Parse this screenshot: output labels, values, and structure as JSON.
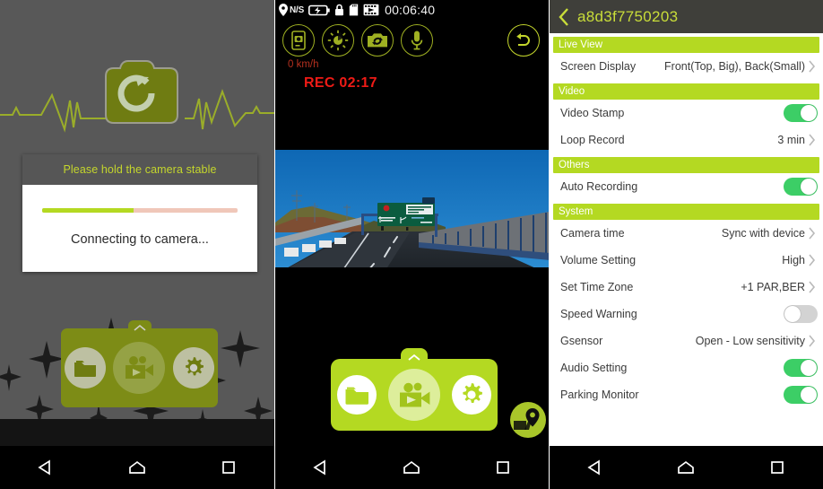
{
  "panels": {
    "connect": {
      "name": "Connecting screen",
      "dialog": {
        "title": "Please hold the camera stable",
        "message": "Connecting to camera...",
        "progress_percent": 47,
        "progress_fill_color": "#b4d922",
        "progress_track_color": "#f0c7b9"
      },
      "logo_icon": "camera-refresh-icon",
      "waveform_icon": "heartbeat-waveform-icon",
      "toolbar": [
        {
          "icon": "folder-icon",
          "label": "Files"
        },
        {
          "icon": "video-camera-icon",
          "label": "Live Record"
        },
        {
          "icon": "gear-icon",
          "label": "Settings"
        }
      ],
      "toolbar_color": "#7d8c16",
      "background_color": "#585858"
    },
    "live": {
      "name": "Live view screen",
      "statusbar": {
        "gps_icon": "location-pin-icon",
        "gps_text": "N/S",
        "battery_icon": "battery-charging-icon",
        "lock_icon": "lock-icon",
        "sdcard_icon": "sd-card-icon",
        "video_icon": "film-strip-icon",
        "clock": "00:06:40"
      },
      "controls": [
        {
          "icon": "phone-snapshot-icon",
          "label": "Save to phone"
        },
        {
          "icon": "brightness-icon",
          "label": "Brightness"
        },
        {
          "icon": "camera-switch-icon",
          "label": "Switch camera"
        },
        {
          "icon": "microphone-icon",
          "label": "Microphone"
        }
      ],
      "back_icon": "undo-arrow-icon",
      "overlay": {
        "speed": "0 km/h",
        "speed_color": "#b5301f",
        "rec_label": "REC 02:17",
        "rec_color": "#ee1b16"
      },
      "toolbar": [
        {
          "icon": "folder-icon",
          "label": "Files"
        },
        {
          "icon": "video-camera-icon",
          "label": "Live Record"
        },
        {
          "icon": "gear-icon",
          "label": "Settings"
        }
      ],
      "toolbar_color": "#b4d922",
      "gps_badge_icon": "map-pin-gps-icon"
    },
    "settings": {
      "name": "Camera settings screen",
      "header": {
        "back_icon": "chevron-left-icon",
        "title": "a8d3f7750203",
        "background_color": "#3f3f3a",
        "title_color": "#c9dd39"
      },
      "group_header_color": "#b4d922",
      "toggle_on_color": "#3cce66",
      "toggle_off_color": "#d3d3d3",
      "groups": [
        {
          "title": "Live View",
          "rows": [
            {
              "label": "Screen Display",
              "type": "link",
              "value": "Front(Top, Big), Back(Small)"
            }
          ]
        },
        {
          "title": "Video",
          "rows": [
            {
              "label": "Video Stamp",
              "type": "toggle",
              "state": "on"
            },
            {
              "label": "Loop Record",
              "type": "link",
              "value": "3 min"
            }
          ]
        },
        {
          "title": "Others",
          "rows": [
            {
              "label": "Auto Recording",
              "type": "toggle",
              "state": "on"
            }
          ]
        },
        {
          "title": "System",
          "rows": [
            {
              "label": "Camera time",
              "type": "link",
              "value": "Sync with device"
            },
            {
              "label": "Volume Setting",
              "type": "link",
              "value": "High"
            },
            {
              "label": "Set Time Zone",
              "type": "link",
              "value": "+1 PAR,BER"
            },
            {
              "label": "Speed Warning",
              "type": "toggle",
              "state": "off"
            },
            {
              "label": "Gsensor",
              "type": "link",
              "value": "Open - Low sensitivity"
            },
            {
              "label": "Audio Setting",
              "type": "toggle",
              "state": "on"
            },
            {
              "label": "Parking Monitor",
              "type": "toggle",
              "state": "on"
            }
          ]
        }
      ]
    }
  },
  "navbar": {
    "back_icon": "triangle-back-icon",
    "home_icon": "home-icon",
    "recents_icon": "square-recents-icon"
  }
}
